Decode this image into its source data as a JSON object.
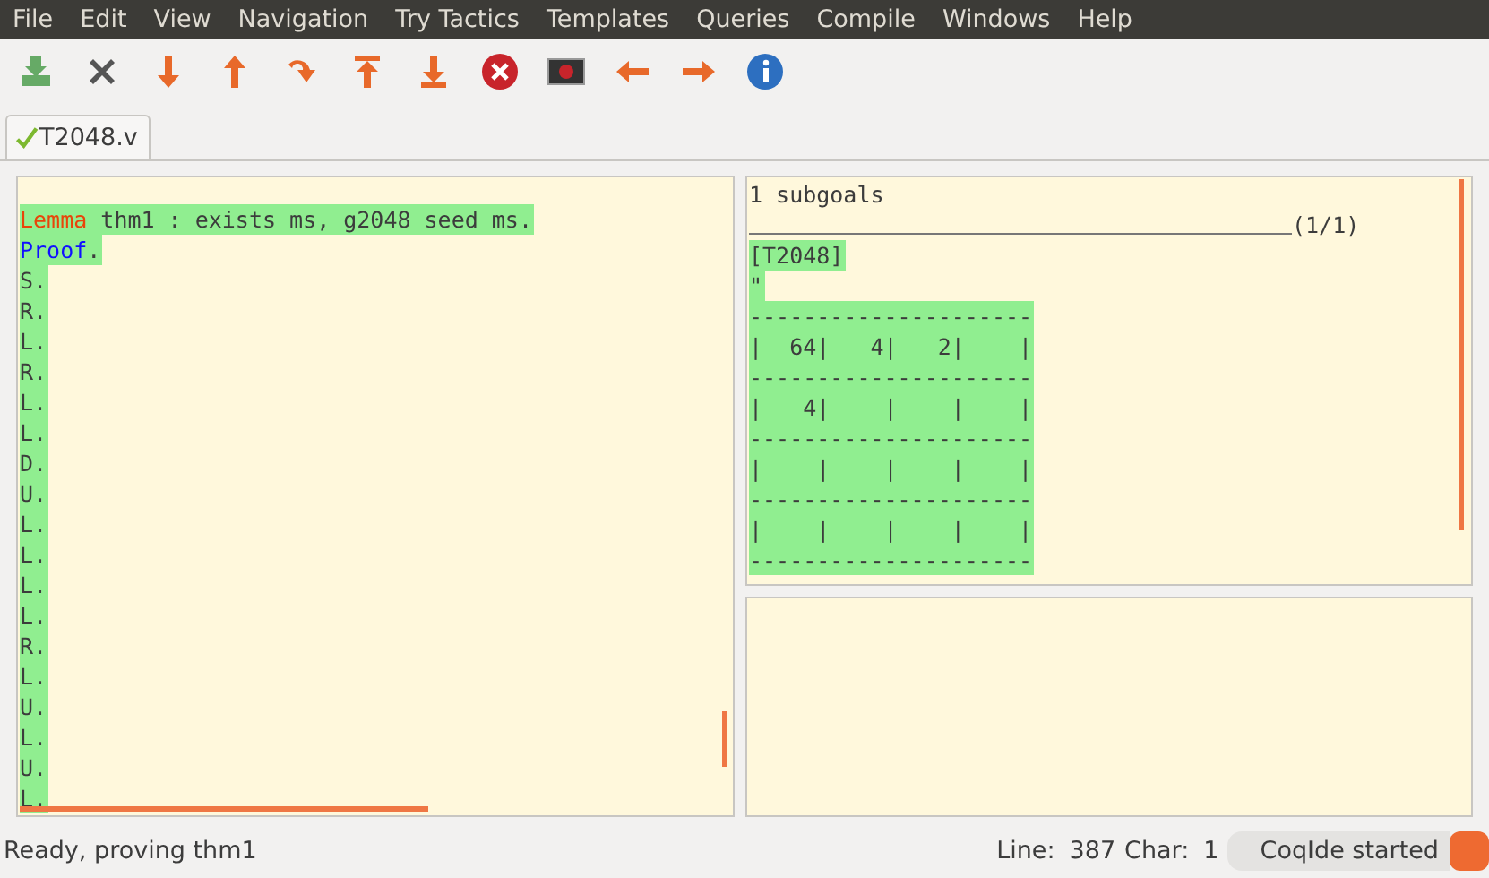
{
  "menu": [
    "File",
    "Edit",
    "View",
    "Navigation",
    "Try Tactics",
    "Templates",
    "Queries",
    "Compile",
    "Windows",
    "Help"
  ],
  "toolbar": [
    {
      "kind": "save"
    },
    {
      "kind": "close"
    },
    {
      "kind": "down"
    },
    {
      "kind": "up"
    },
    {
      "kind": "curve"
    },
    {
      "kind": "top"
    },
    {
      "kind": "bottom"
    },
    {
      "kind": "stop"
    },
    {
      "kind": "break"
    },
    {
      "kind": "left"
    },
    {
      "kind": "right"
    },
    {
      "kind": "info"
    }
  ],
  "tabs": [
    {
      "label": "T2048.v",
      "selected": true,
      "checked": true
    }
  ],
  "script": {
    "lines": [
      {
        "processed": true,
        "parts": [
          {
            "kind": "keyword",
            "text": "Lemma"
          },
          {
            "kind": "plain",
            "text": " thm1 : exists ms, g2048 seed ms."
          }
        ]
      },
      {
        "processed": true,
        "parts": [
          {
            "kind": "command",
            "text": "Proof"
          },
          {
            "kind": "plain",
            "text": "."
          }
        ]
      },
      {
        "processed": true,
        "parts": [
          {
            "kind": "plain",
            "text": "S."
          }
        ]
      },
      {
        "processed": true,
        "parts": [
          {
            "kind": "plain",
            "text": "R."
          }
        ]
      },
      {
        "processed": true,
        "parts": [
          {
            "kind": "plain",
            "text": "L."
          }
        ]
      },
      {
        "processed": true,
        "parts": [
          {
            "kind": "plain",
            "text": "R."
          }
        ]
      },
      {
        "processed": true,
        "parts": [
          {
            "kind": "plain",
            "text": "L."
          }
        ]
      },
      {
        "processed": true,
        "parts": [
          {
            "kind": "plain",
            "text": "L."
          }
        ]
      },
      {
        "processed": true,
        "parts": [
          {
            "kind": "plain",
            "text": "D."
          }
        ]
      },
      {
        "processed": true,
        "parts": [
          {
            "kind": "plain",
            "text": "U."
          }
        ]
      },
      {
        "processed": true,
        "parts": [
          {
            "kind": "plain",
            "text": "L."
          }
        ]
      },
      {
        "processed": true,
        "parts": [
          {
            "kind": "plain",
            "text": "L."
          }
        ]
      },
      {
        "processed": true,
        "parts": [
          {
            "kind": "plain",
            "text": "L."
          }
        ]
      },
      {
        "processed": true,
        "parts": [
          {
            "kind": "plain",
            "text": "L."
          }
        ]
      },
      {
        "processed": true,
        "parts": [
          {
            "kind": "plain",
            "text": "R."
          }
        ]
      },
      {
        "processed": true,
        "parts": [
          {
            "kind": "plain",
            "text": "L."
          }
        ]
      },
      {
        "processed": true,
        "parts": [
          {
            "kind": "plain",
            "text": "U."
          }
        ]
      },
      {
        "processed": true,
        "parts": [
          {
            "kind": "plain",
            "text": "L."
          }
        ]
      },
      {
        "processed": true,
        "parts": [
          {
            "kind": "plain",
            "text": "U."
          }
        ]
      },
      {
        "processed": true,
        "parts": [
          {
            "kind": "plain",
            "text": "L."
          }
        ]
      }
    ]
  },
  "goals": {
    "count": "1 subgoals",
    "index": "(1/1)",
    "lines": [
      {
        "processed": true,
        "text": "[T2048]"
      },
      {
        "processed": true,
        "text": "\""
      },
      {
        "processed": true,
        "text": "---------------------"
      },
      {
        "processed": true,
        "text": "|  64|   4|   2|    |"
      },
      {
        "processed": true,
        "text": "---------------------"
      },
      {
        "processed": true,
        "text": "|   4|    |    |    |"
      },
      {
        "processed": true,
        "text": "---------------------"
      },
      {
        "processed": true,
        "text": "|    |    |    |    |"
      },
      {
        "processed": true,
        "text": "---------------------"
      },
      {
        "processed": true,
        "text": "|    |    |    |    |"
      },
      {
        "processed": true,
        "text": "---------------------"
      }
    ]
  },
  "status_bar": {
    "message": "Ready, proving thm1",
    "line_label": "Line:",
    "line": "387",
    "char_label": "Char:",
    "char": "1",
    "coq_status": "CoqIde started"
  }
}
